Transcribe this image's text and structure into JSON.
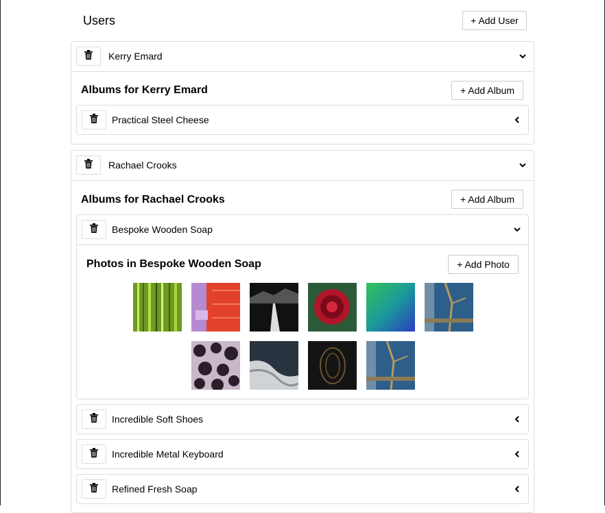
{
  "header": {
    "title": "Users",
    "add_user_label": "+ Add User"
  },
  "users": [
    {
      "name": "Kerry Emard",
      "albums_heading": "Albums for Kerry Emard",
      "add_album_label": "+ Add Album",
      "albums": [
        {
          "title": "Practical Steel Cheese",
          "expanded": false
        }
      ]
    },
    {
      "name": "Rachael Crooks",
      "albums_heading": "Albums for Rachael Crooks",
      "add_album_label": "+ Add Album",
      "albums": [
        {
          "title": "Bespoke Wooden Soap",
          "expanded": true,
          "photos_heading": "Photos in Bespoke Wooden Soap",
          "add_photo_label": "+ Add Photo",
          "photo_count": 10
        },
        {
          "title": "Incredible Soft Shoes",
          "expanded": false
        },
        {
          "title": "Incredible Metal Keyboard",
          "expanded": false
        },
        {
          "title": "Refined Fresh Soap",
          "expanded": false
        }
      ]
    }
  ],
  "icons": {
    "delete": "trash-icon",
    "expand": "chevron-down-icon",
    "collapse": "chevron-left-icon"
  }
}
